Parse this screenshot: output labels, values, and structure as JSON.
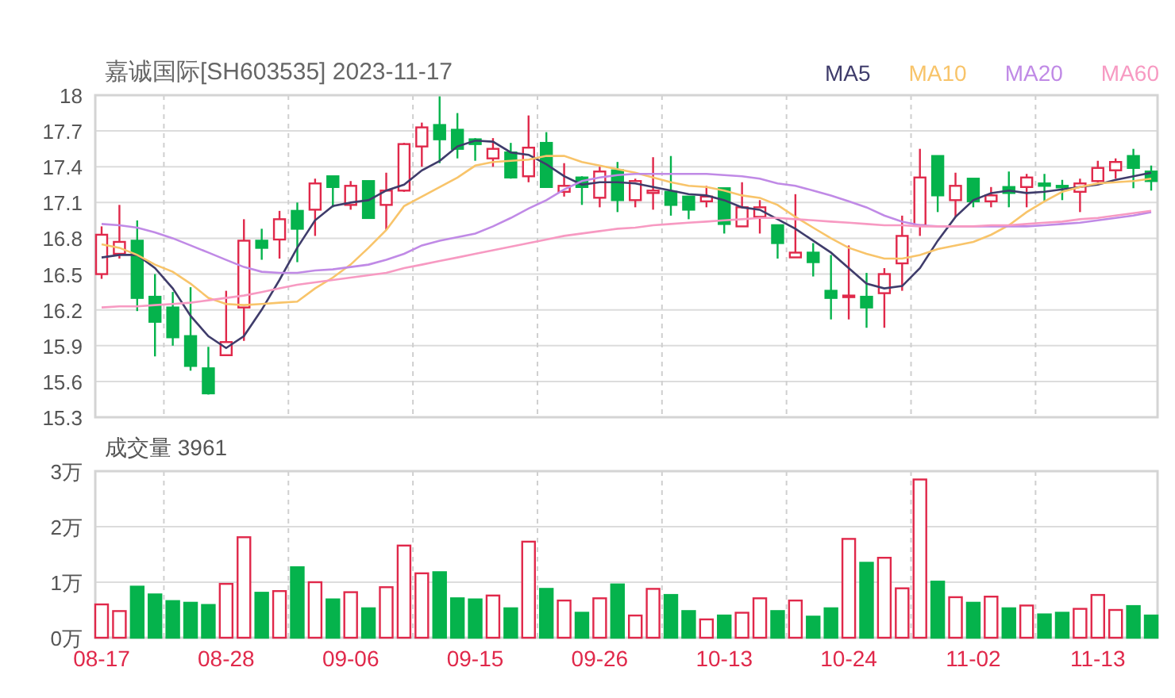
{
  "price_chart": {
    "chart_data": {
      "type": "candlestick",
      "title": "嘉诚国际[SH603535] 2023-11-17",
      "grid": true,
      "ylim": [
        15.3,
        18
      ],
      "yticks": [
        18,
        17.7,
        17.4,
        17.1,
        16.8,
        16.5,
        16.2,
        15.9,
        15.6,
        15.3
      ],
      "categories": [
        null,
        null,
        null,
        null,
        null,
        null,
        null,
        null,
        null,
        null,
        null,
        null,
        null,
        null,
        null,
        null,
        null,
        null,
        null,
        null,
        null,
        null,
        null,
        null,
        null,
        null,
        null,
        null,
        null,
        null,
        null,
        null,
        null,
        null,
        null,
        null,
        null,
        null,
        null,
        null,
        null,
        null,
        null,
        null,
        null,
        null,
        null,
        null,
        null,
        null,
        null,
        null,
        null,
        null,
        null,
        null,
        null,
        null,
        null,
        null
      ],
      "ohlc": [
        [
          16.5,
          16.9,
          16.46,
          16.83
        ],
        [
          16.67,
          17.08,
          16.63,
          16.77
        ],
        [
          16.78,
          16.95,
          16.19,
          16.3
        ],
        [
          16.31,
          16.5,
          15.81,
          16.1
        ],
        [
          16.22,
          16.35,
          15.9,
          15.97
        ],
        [
          15.98,
          16.39,
          15.69,
          15.73
        ],
        [
          15.71,
          15.89,
          15.49,
          15.5
        ],
        [
          15.82,
          16.36,
          15.82,
          15.93
        ],
        [
          16.22,
          16.96,
          15.94,
          16.78
        ],
        [
          16.78,
          16.88,
          16.62,
          16.72
        ],
        [
          16.79,
          17.03,
          16.63,
          16.96
        ],
        [
          17.03,
          17.1,
          16.6,
          16.88
        ],
        [
          17.04,
          17.3,
          16.82,
          17.26
        ],
        [
          17.32,
          17.32,
          17.06,
          17.23
        ],
        [
          17.08,
          17.28,
          17.04,
          17.24
        ],
        [
          17.28,
          17.28,
          16.97,
          16.97
        ],
        [
          17.08,
          17.35,
          16.87,
          17.2
        ],
        [
          17.2,
          17.6,
          17.19,
          17.59
        ],
        [
          17.57,
          17.77,
          17.4,
          17.73
        ],
        [
          17.75,
          17.99,
          17.43,
          17.63
        ],
        [
          17.71,
          17.85,
          17.47,
          17.55
        ],
        [
          17.63,
          17.64,
          17.45,
          17.59
        ],
        [
          17.47,
          17.64,
          17.4,
          17.55
        ],
        [
          17.52,
          17.6,
          17.3,
          17.31
        ],
        [
          17.32,
          17.83,
          17.27,
          17.56
        ],
        [
          17.6,
          17.69,
          17.23,
          17.23
        ],
        [
          17.19,
          17.43,
          17.15,
          17.24
        ],
        [
          17.31,
          17.32,
          17.08,
          17.23
        ],
        [
          17.14,
          17.4,
          17.06,
          17.36
        ],
        [
          17.37,
          17.44,
          17.02,
          17.12
        ],
        [
          17.12,
          17.3,
          17.06,
          17.28
        ],
        [
          17.18,
          17.48,
          17.04,
          17.2
        ],
        [
          17.19,
          17.49,
          16.99,
          17.08
        ],
        [
          17.15,
          17.15,
          16.96,
          17.04
        ],
        [
          17.11,
          17.24,
          17.06,
          17.15
        ],
        [
          17.22,
          17.22,
          16.84,
          16.92
        ],
        [
          16.9,
          17.27,
          16.9,
          17.06
        ],
        [
          16.98,
          17.12,
          16.84,
          17.06
        ],
        [
          16.91,
          16.91,
          16.63,
          16.76
        ],
        [
          16.64,
          17.17,
          16.64,
          16.68
        ],
        [
          16.68,
          16.76,
          16.48,
          16.6
        ],
        [
          16.36,
          16.66,
          16.12,
          16.3
        ],
        [
          16.31,
          16.74,
          16.12,
          16.32
        ],
        [
          16.31,
          16.51,
          16.05,
          16.22
        ],
        [
          16.34,
          16.55,
          16.05,
          16.5
        ],
        [
          16.59,
          16.99,
          16.36,
          16.82
        ],
        [
          16.91,
          17.55,
          16.82,
          17.31
        ],
        [
          17.49,
          17.49,
          17.02,
          17.16
        ],
        [
          17.12,
          17.35,
          16.98,
          17.24
        ],
        [
          17.3,
          17.3,
          17.06,
          17.11
        ],
        [
          17.11,
          17.23,
          17.06,
          17.16
        ],
        [
          17.23,
          17.36,
          17.06,
          17.18
        ],
        [
          17.23,
          17.34,
          17.06,
          17.31
        ],
        [
          17.26,
          17.34,
          17.11,
          17.24
        ],
        [
          17.24,
          17.29,
          17.12,
          17.23
        ],
        [
          17.19,
          17.3,
          17.02,
          17.26
        ],
        [
          17.28,
          17.45,
          17.27,
          17.39
        ],
        [
          17.37,
          17.47,
          17.3,
          17.44
        ],
        [
          17.49,
          17.55,
          17.22,
          17.39
        ],
        [
          17.36,
          17.41,
          17.2,
          17.28
        ]
      ]
    }
  },
  "moving_averages": {
    "chart_data": {
      "type": "line",
      "ylim": [
        15.3,
        18
      ],
      "categories": [
        null,
        null,
        null,
        null,
        null,
        null,
        null,
        null,
        null,
        null,
        null,
        null,
        null,
        null,
        null,
        null,
        null,
        null,
        null,
        null,
        null,
        null,
        null,
        null,
        null,
        null,
        null,
        null,
        null,
        null,
        null,
        null,
        null,
        null,
        null,
        null,
        null,
        null,
        null,
        null,
        null,
        null,
        null,
        null,
        null,
        null,
        null,
        null,
        null,
        null,
        null,
        null,
        null,
        null,
        null,
        null,
        null,
        null,
        null,
        null
      ],
      "series": [
        {
          "name": "MA5",
          "color": "#3f3c6b",
          "values": [
            16.64,
            16.66,
            16.66,
            16.55,
            16.38,
            16.15,
            15.98,
            15.88,
            15.98,
            16.2,
            16.45,
            16.72,
            16.95,
            17.07,
            17.1,
            17.12,
            17.2,
            17.25,
            17.37,
            17.45,
            17.57,
            17.62,
            17.61,
            17.52,
            17.5,
            17.42,
            17.32,
            17.25,
            17.27,
            17.27,
            17.26,
            17.23,
            17.2,
            17.17,
            17.16,
            17.12,
            17.06,
            17.04,
            16.96,
            16.88,
            16.78,
            16.68,
            16.55,
            16.42,
            16.38,
            16.4,
            16.55,
            16.78,
            16.98,
            17.12,
            17.18,
            17.2,
            17.18,
            17.19,
            17.21,
            17.23,
            17.25,
            17.29,
            17.32,
            17.35
          ]
        },
        {
          "name": "MA10",
          "color": "#f8c46a",
          "values": [
            16.75,
            16.72,
            16.66,
            16.58,
            16.52,
            16.42,
            16.3,
            16.25,
            16.24,
            16.25,
            16.26,
            16.27,
            16.38,
            16.47,
            16.58,
            16.72,
            16.87,
            17.07,
            17.15,
            17.23,
            17.31,
            17.41,
            17.44,
            17.45,
            17.46,
            17.49,
            17.49,
            17.44,
            17.41,
            17.38,
            17.35,
            17.31,
            17.27,
            17.24,
            17.23,
            17.2,
            17.16,
            17.14,
            17.08,
            16.98,
            16.89,
            16.8,
            16.72,
            16.67,
            16.63,
            16.63,
            16.66,
            16.71,
            16.74,
            16.77,
            16.83,
            16.91,
            17.02,
            17.11,
            17.19,
            17.23,
            17.26,
            17.27,
            17.28,
            17.3
          ]
        },
        {
          "name": "MA20",
          "color": "#c08ae6",
          "values": [
            16.92,
            16.91,
            16.89,
            16.85,
            16.8,
            16.74,
            16.68,
            16.62,
            16.56,
            16.52,
            16.51,
            16.51,
            16.53,
            16.54,
            16.56,
            16.58,
            16.62,
            16.67,
            16.74,
            16.78,
            16.81,
            16.84,
            16.9,
            16.97,
            17.05,
            17.12,
            17.21,
            17.28,
            17.31,
            17.33,
            17.34,
            17.34,
            17.34,
            17.34,
            17.34,
            17.33,
            17.32,
            17.3,
            17.26,
            17.24,
            17.2,
            17.16,
            17.11,
            17.06,
            16.99,
            16.94,
            16.91,
            16.9,
            16.9,
            16.9,
            16.9,
            16.9,
            16.9,
            16.91,
            16.92,
            16.93,
            16.95,
            16.97,
            16.99,
            17.02
          ]
        },
        {
          "name": "MA60",
          "color": "#f79ac2",
          "values": [
            16.22,
            16.23,
            16.23,
            16.24,
            16.25,
            16.26,
            16.28,
            16.3,
            16.32,
            16.35,
            16.38,
            16.41,
            16.43,
            16.45,
            16.47,
            16.49,
            16.51,
            16.55,
            16.58,
            16.61,
            16.64,
            16.67,
            16.7,
            16.73,
            16.76,
            16.79,
            16.82,
            16.84,
            16.86,
            16.88,
            16.89,
            16.91,
            16.92,
            16.93,
            16.94,
            16.95,
            16.96,
            16.97,
            16.97,
            16.96,
            16.95,
            16.94,
            16.93,
            16.92,
            16.91,
            16.91,
            16.9,
            16.9,
            16.9,
            16.9,
            16.91,
            16.91,
            16.92,
            16.93,
            16.94,
            16.96,
            16.97,
            16.99,
            17.01,
            17.03
          ]
        }
      ]
    }
  },
  "volume_chart": {
    "chart_data": {
      "type": "bar",
      "title": "成交量 3961",
      "grid": true,
      "ylim": [
        0,
        3
      ],
      "yticks": [
        {
          "value": 3,
          "label": "3万"
        },
        {
          "value": 2,
          "label": "2万"
        },
        {
          "value": 1,
          "label": "1万"
        },
        {
          "value": 0,
          "label": "0万"
        }
      ],
      "categories": [
        "08-17",
        null,
        null,
        null,
        null,
        null,
        null,
        "08-28",
        null,
        null,
        null,
        null,
        null,
        null,
        "09-06",
        null,
        null,
        null,
        null,
        null,
        null,
        "09-15",
        null,
        null,
        null,
        null,
        null,
        null,
        "09-26",
        null,
        null,
        null,
        null,
        null,
        null,
        "10-13",
        null,
        null,
        null,
        null,
        null,
        null,
        "10-24",
        null,
        null,
        null,
        null,
        null,
        null,
        "11-02",
        null,
        null,
        null,
        null,
        null,
        null,
        "11-13",
        null,
        null,
        null
      ],
      "series": [
        {
          "values": [
            0.6,
            0.48,
            0.92,
            0.78,
            0.66,
            0.63,
            0.59,
            0.97,
            1.81,
            0.81,
            0.84,
            1.27,
            1.0,
            0.69,
            0.82,
            0.53,
            0.91,
            1.66,
            1.16,
            1.18,
            0.71,
            0.69,
            0.76,
            0.53,
            1.73,
            0.88,
            0.67,
            0.45,
            0.71,
            0.96,
            0.4,
            0.88,
            0.77,
            0.48,
            0.33,
            0.4,
            0.45,
            0.71,
            0.48,
            0.67,
            0.38,
            0.53,
            1.78,
            1.35,
            1.44,
            0.89,
            2.85,
            1.01,
            0.73,
            0.63,
            0.74,
            0.53,
            0.58,
            0.42,
            0.45,
            0.52,
            0.77,
            0.5,
            0.57,
            0.4
          ]
        }
      ]
    }
  }
}
